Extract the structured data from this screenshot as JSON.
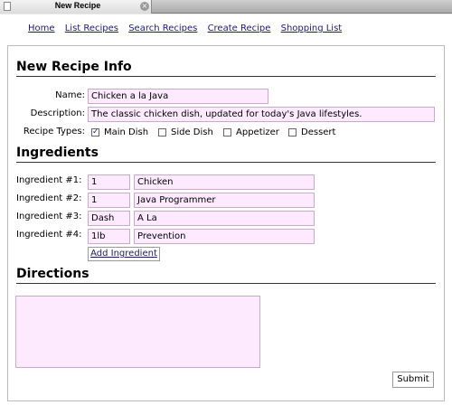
{
  "tab": {
    "title": "New Recipe",
    "close_glyph": "×"
  },
  "nav": {
    "links": [
      "Home",
      "List Recipes",
      "Search Recipes",
      "Create Recipe",
      "Shopping List"
    ]
  },
  "info": {
    "heading": "New Recipe Info",
    "name_label": "Name:",
    "name_value": "Chicken a la Java",
    "description_label": "Description:",
    "description_value": "The classic chicken dish, updated for today's Java lifestyles.",
    "types_label": "Recipe Types:",
    "types": [
      {
        "label": "Main Dish",
        "checked": true
      },
      {
        "label": "Side Dish",
        "checked": false
      },
      {
        "label": "Appetizer",
        "checked": false
      },
      {
        "label": "Dessert",
        "checked": false
      }
    ]
  },
  "ingredients": {
    "heading": "Ingredients",
    "rows": [
      {
        "label": "Ingredient #1:",
        "qty": "1",
        "item": "Chicken"
      },
      {
        "label": "Ingredient #2:",
        "qty": "1",
        "item": "Java Programmer"
      },
      {
        "label": "Ingredient #3:",
        "qty": "Dash",
        "item": "A La"
      },
      {
        "label": "Ingredient #4:",
        "qty": "1lb",
        "item": "Prevention"
      }
    ],
    "add_label": "Add Ingredient"
  },
  "directions": {
    "heading": "Directions",
    "value": ""
  },
  "submit_label": "Submit",
  "colors": {
    "field_bg": "#fdeaff",
    "link": "#1a1a7a"
  }
}
